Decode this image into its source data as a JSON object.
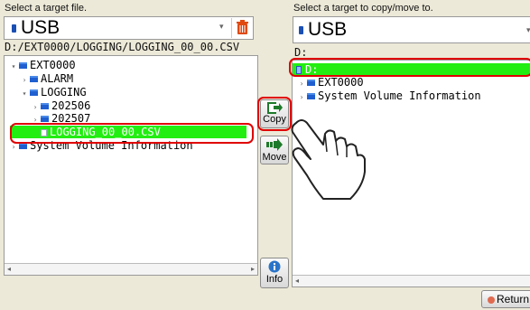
{
  "left": {
    "heading": "Select a target file.",
    "device": "USB",
    "path": "D:/EXT0000/LOGGING/LOGGING_00_00.CSV",
    "tree": [
      {
        "label": "EXT0000",
        "arrow": "▾",
        "icon": "folder"
      },
      {
        "label": "ALARM",
        "arrow": "›",
        "icon": "folder"
      },
      {
        "label": "LOGGING",
        "arrow": "▾",
        "icon": "folder"
      },
      {
        "label": "202506",
        "arrow": "›",
        "icon": "folder"
      },
      {
        "label": "202507",
        "arrow": "›",
        "icon": "folder"
      },
      {
        "label": "LOGGING_00_00.CSV",
        "arrow": "",
        "icon": "file"
      },
      {
        "label": "System Volume Information",
        "arrow": "›",
        "icon": "folder"
      }
    ]
  },
  "right": {
    "heading": "Select a target to copy/move to.",
    "device": "USB",
    "path": "D:",
    "tree": [
      {
        "label": "D:",
        "arrow": "",
        "icon": "drive"
      },
      {
        "label": "EXT0000",
        "arrow": "›",
        "icon": "folder"
      },
      {
        "label": "System Volume Information",
        "arrow": "›",
        "icon": "folder"
      }
    ]
  },
  "actions": {
    "copy": "Copy",
    "move": "Move",
    "info": "Info",
    "return": "Return"
  },
  "colors": {
    "selection": "#22ee11",
    "highlight": "#e00000",
    "folder": "#1f5fd0"
  },
  "icons": [
    "usb-icon",
    "delete-icon",
    "folder-icon",
    "file-icon",
    "copy-icon",
    "move-icon",
    "info-icon",
    "return-icon",
    "hand-pointer-icon"
  ]
}
